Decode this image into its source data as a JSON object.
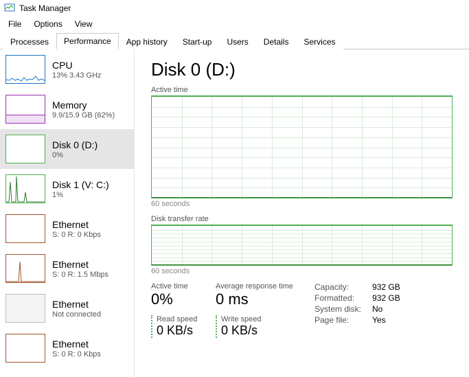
{
  "window": {
    "title": "Task Manager"
  },
  "menu": {
    "file": "File",
    "options": "Options",
    "view": "View"
  },
  "tabs": {
    "processes": "Processes",
    "performance": "Performance",
    "app_history": "App history",
    "startup": "Start-up",
    "users": "Users",
    "details": "Details",
    "services": "Services"
  },
  "sidebar": [
    {
      "title": "CPU",
      "sub": "13% 3.43 GHz"
    },
    {
      "title": "Memory",
      "sub": "9.9/15.9 GB (62%)"
    },
    {
      "title": "Disk 0 (D:)",
      "sub": "0%"
    },
    {
      "title": "Disk 1 (V: C:)",
      "sub": "1%"
    },
    {
      "title": "Ethernet",
      "sub": "S: 0 R: 0 Kbps"
    },
    {
      "title": "Ethernet",
      "sub": "S: 0 R: 1.5 Mbps"
    },
    {
      "title": "Ethernet",
      "sub": "Not connected"
    },
    {
      "title": "Ethernet",
      "sub": "S: 0 R: 0 Kbps"
    }
  ],
  "main": {
    "title": "Disk 0 (D:)",
    "chart_active_label": "Active time",
    "chart_transfer_label": "Disk transfer rate",
    "axis_label": "60 seconds",
    "stats": {
      "active_time_label": "Active time",
      "active_time_value": "0%",
      "avg_resp_label": "Average response time",
      "avg_resp_value": "0 ms",
      "read_label": "Read speed",
      "read_value": "0 KB/s",
      "write_label": "Write speed",
      "write_value": "0 KB/s"
    },
    "props": {
      "capacity_k": "Capacity:",
      "capacity_v": "932 GB",
      "formatted_k": "Formatted:",
      "formatted_v": "932 GB",
      "system_k": "System disk:",
      "system_v": "No",
      "page_k": "Page file:",
      "page_v": "Yes"
    }
  },
  "chart_data": {
    "type": "line",
    "charts": [
      {
        "name": "Active time",
        "x_range_seconds": 60,
        "ylim": [
          0,
          100
        ],
        "series": [
          {
            "name": "Active time %",
            "flat_value": 0
          }
        ]
      },
      {
        "name": "Disk transfer rate",
        "x_range_seconds": 60,
        "series": [
          {
            "name": "Read",
            "flat_value": 0
          },
          {
            "name": "Write",
            "flat_value": 0
          }
        ]
      }
    ]
  }
}
